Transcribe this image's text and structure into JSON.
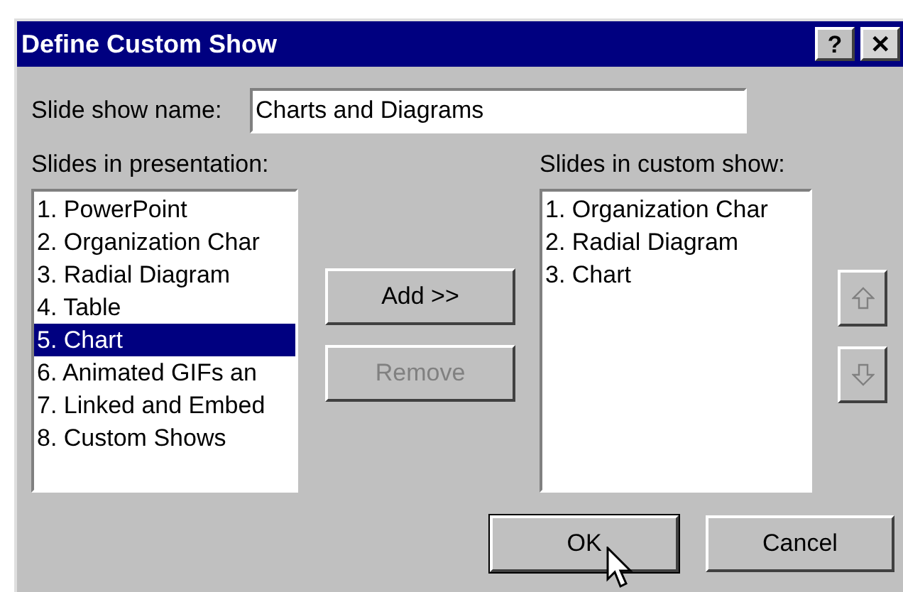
{
  "window": {
    "title": "Define Custom Show",
    "title_buttons": [
      {
        "kind": "help",
        "label": "?"
      },
      {
        "kind": "close",
        "label": "✕"
      }
    ]
  },
  "name_field": {
    "label": "Slide show name:",
    "value": "Charts and Diagrams"
  },
  "presentation_list": {
    "label": "Slides in presentation:",
    "items": [
      {
        "text": "1. PowerPoint",
        "selected": false
      },
      {
        "text": "2. Organization Char",
        "selected": false
      },
      {
        "text": "3. Radial Diagram",
        "selected": false
      },
      {
        "text": "4. Table",
        "selected": false
      },
      {
        "text": "5. Chart",
        "selected": true
      },
      {
        "text": "6. Animated GIFs an",
        "selected": false
      },
      {
        "text": "7. Linked and Embed",
        "selected": false
      },
      {
        "text": "8. Custom Shows",
        "selected": false
      }
    ]
  },
  "middle_buttons": [
    {
      "label": "Add >>",
      "disabled": false
    },
    {
      "label": "Remove",
      "disabled": true
    }
  ],
  "custom_show_list": {
    "label": "Slides in custom show:",
    "items": [
      {
        "text": "1. Organization Char",
        "selected": false
      },
      {
        "text": "2. Radial Diagram",
        "selected": false
      },
      {
        "text": "3. Chart",
        "selected": false
      }
    ]
  },
  "order_buttons": [
    {
      "kind": "up",
      "disabled": true
    },
    {
      "kind": "down",
      "disabled": true
    }
  ],
  "dialog_buttons": [
    {
      "label": "OK",
      "default": true
    },
    {
      "label": "Cancel",
      "default": false
    }
  ]
}
